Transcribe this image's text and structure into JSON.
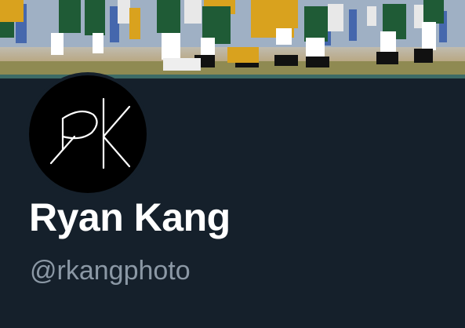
{
  "profile": {
    "display_name": "Ryan Kang",
    "handle": "@rkangphoto",
    "avatar_monogram": "RK"
  },
  "banner": {
    "subject": "football players on field"
  },
  "colors": {
    "background": "#15202b",
    "name_text": "#ffffff",
    "handle_text": "#8b98a5",
    "avatar_bg": "#000000"
  }
}
